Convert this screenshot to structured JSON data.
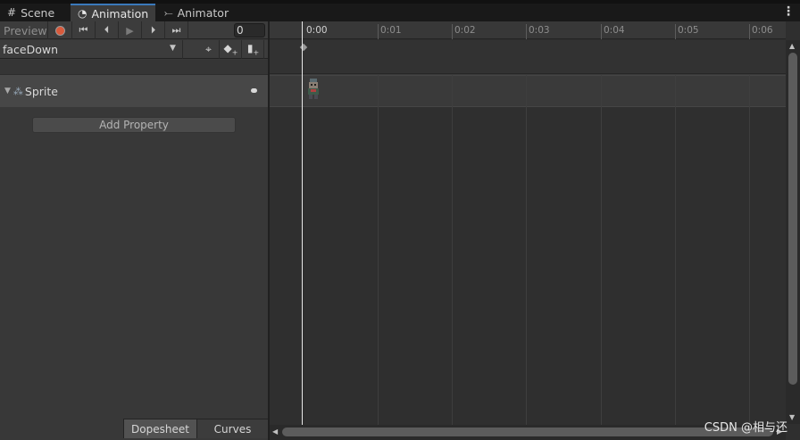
{
  "tabs": [
    {
      "label": "Scene",
      "icon": "grid-icon"
    },
    {
      "label": "Animation",
      "icon": "clock-icon"
    },
    {
      "label": "Animator",
      "icon": "animator-graph-icon"
    }
  ],
  "toolbar": {
    "preview_label": "Preview",
    "frame_value": "0",
    "clip_name": "faceDown"
  },
  "properties": {
    "sprite_label": "Sprite",
    "add_property_label": "Add Property"
  },
  "view_tabs": {
    "dopesheet": "Dopesheet",
    "curves": "Curves"
  },
  "timeline": {
    "labels": [
      "0:00",
      "0:01",
      "0:02",
      "0:03",
      "0:04",
      "0:05",
      "0:06"
    ],
    "current_time": "0:00"
  },
  "watermark": "CSDN @相与还"
}
